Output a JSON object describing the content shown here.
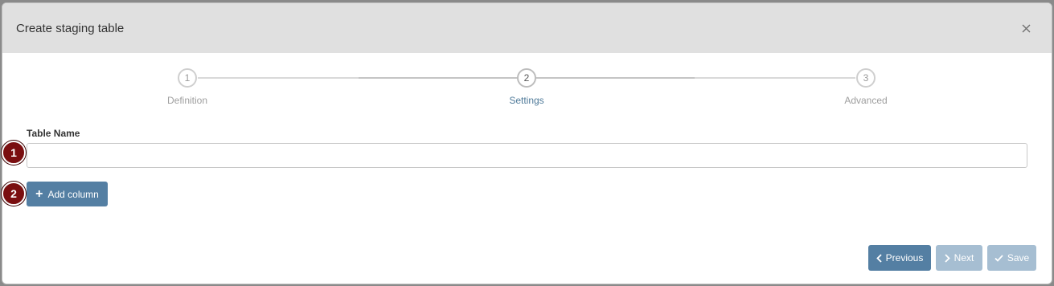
{
  "dialog": {
    "title": "Create staging table",
    "close_icon": "close-icon"
  },
  "stepper": {
    "steps": [
      {
        "number": "1",
        "label": "Definition",
        "state": "inactive"
      },
      {
        "number": "2",
        "label": "Settings",
        "state": "active"
      },
      {
        "number": "3",
        "label": "Advanced",
        "state": "inactive"
      }
    ]
  },
  "form": {
    "table_name_label": "Table Name",
    "table_name_value": "",
    "add_column_label": "Add column",
    "add_column_icon": "plus-icon"
  },
  "annotations": {
    "badge_1": "1",
    "badge_2": "2"
  },
  "footer": {
    "previous_label": "Previous",
    "previous_icon": "chevron-left-icon",
    "next_label": "Next",
    "next_icon": "chevron-right-icon",
    "save_label": "Save",
    "save_icon": "check-icon"
  },
  "colors": {
    "header_bg": "#e0e0e0",
    "primary_button": "#547fa3",
    "disabled_button": "#a6bed2",
    "active_step_label": "#4f7a99",
    "badge": "#7a0e10"
  }
}
